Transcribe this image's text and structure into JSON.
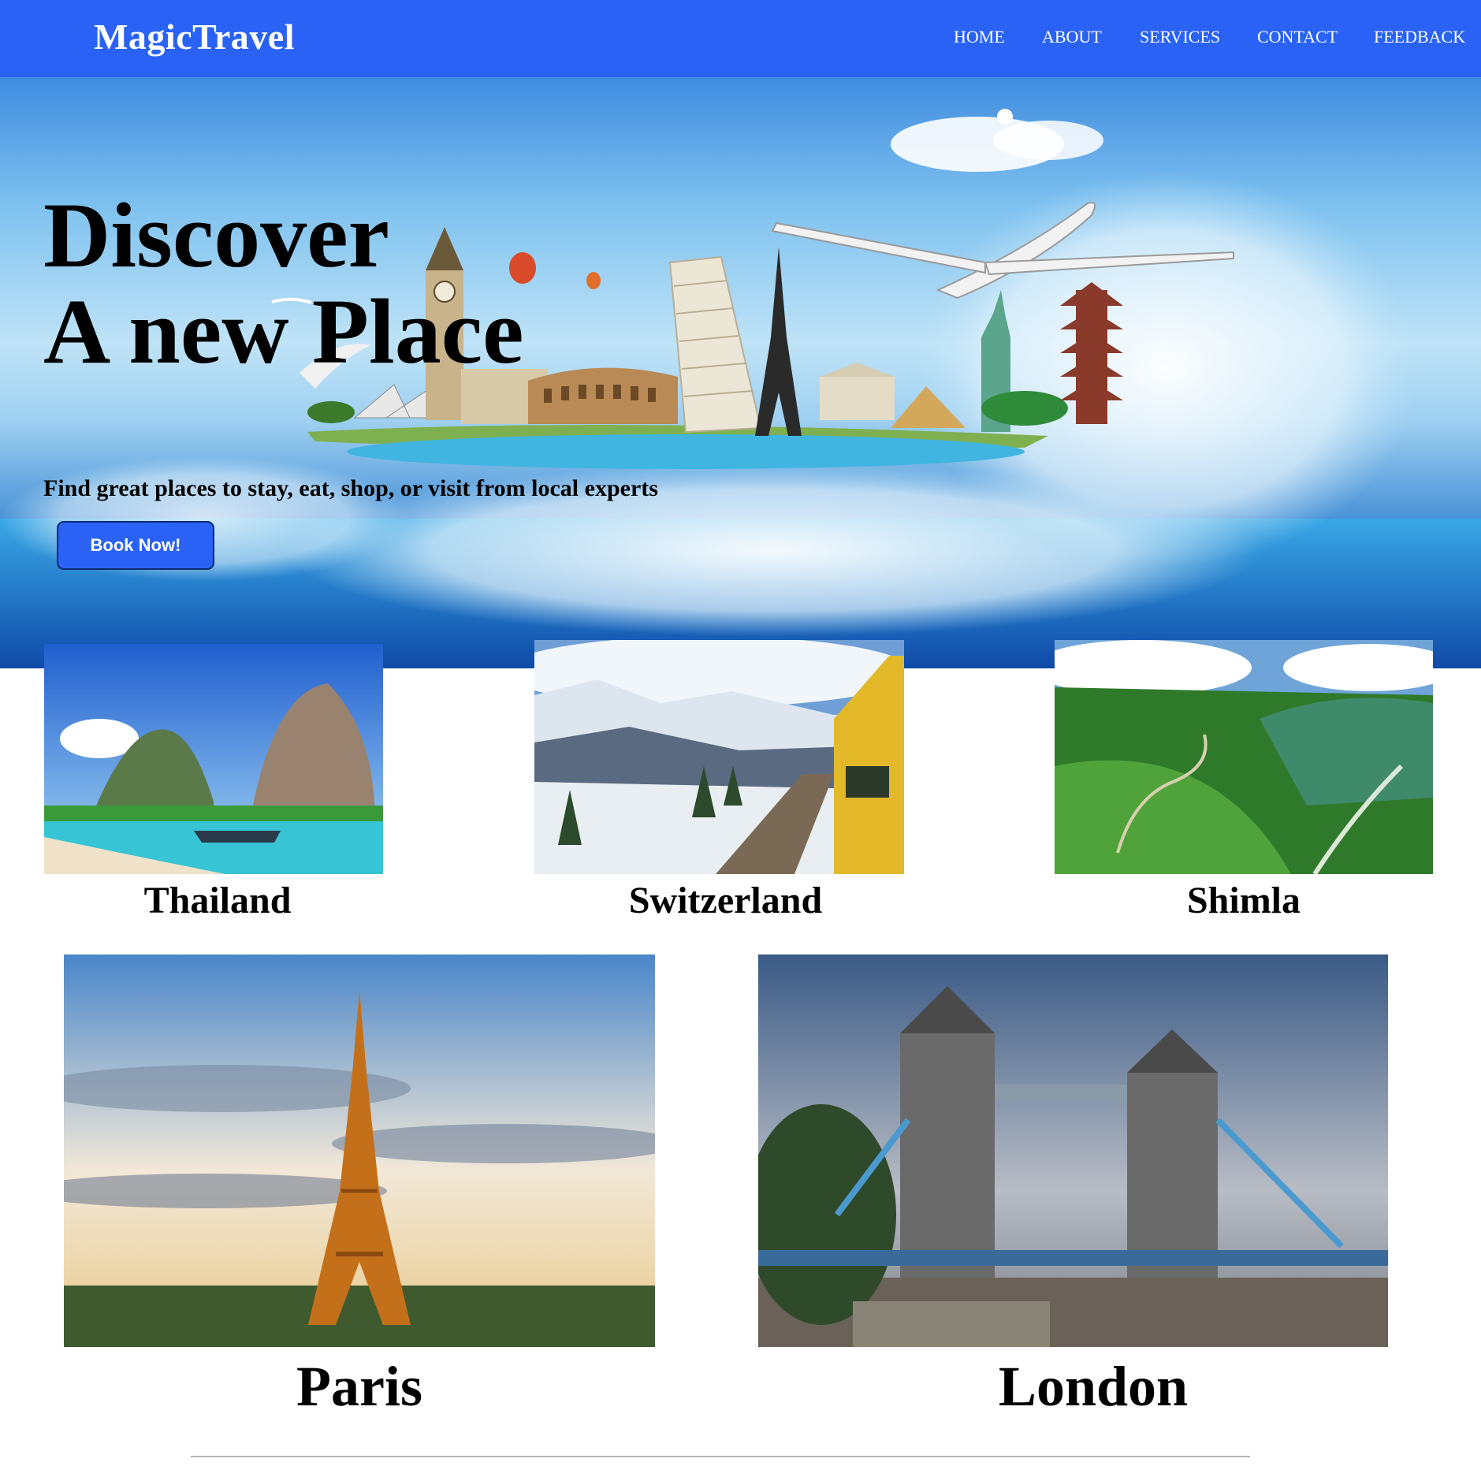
{
  "brand": {
    "name": "MagicTravel"
  },
  "nav": {
    "items": [
      "HOME",
      "ABOUT",
      "SERVICES",
      "CONTACT",
      "FEEDBACK"
    ]
  },
  "hero": {
    "title_line1": "Discover",
    "title_line2": "A new Place",
    "subtitle": "Find great places to stay, eat, shop, or visit from local experts",
    "cta_label": "Book Now!"
  },
  "destinations": {
    "row1": [
      "Thailand",
      "Switzerland",
      "Shimla"
    ],
    "row2": [
      "Paris",
      "London"
    ]
  },
  "colors": {
    "brand_blue": "#2962f5",
    "text": "#000000",
    "nav_text": "#ffffff"
  }
}
